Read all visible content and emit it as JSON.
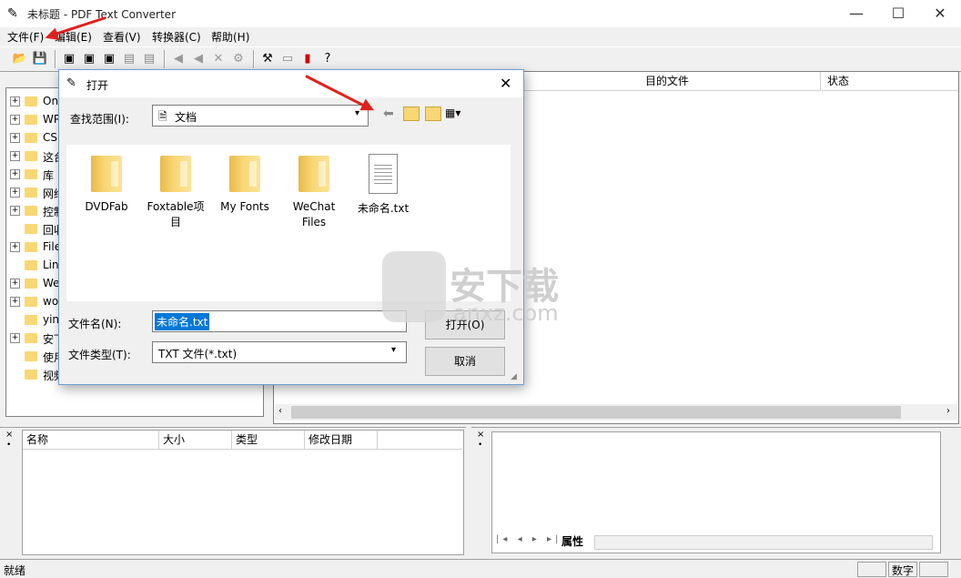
{
  "window": {
    "title": "未标题 - PDF Text Converter",
    "minimize": "—",
    "maximize": "☐",
    "close": "✕"
  },
  "menu": [
    "文件(F)",
    "编辑(E)",
    "查看(V)",
    "转换器(C)",
    "帮助(H)"
  ],
  "tree": {
    "items": [
      {
        "label": "On",
        "expander": "+"
      },
      {
        "label": "WP",
        "expander": "+"
      },
      {
        "label": "CS",
        "expander": "+"
      },
      {
        "label": "这台",
        "expander": "+"
      },
      {
        "label": "库",
        "expander": "+"
      },
      {
        "label": "网络",
        "expander": "+"
      },
      {
        "label": "控制",
        "expander": "+"
      },
      {
        "label": "回收",
        "expander": ""
      },
      {
        "label": "File",
        "expander": "+"
      },
      {
        "label": "Lin",
        "expander": ""
      },
      {
        "label": "We",
        "expander": "+"
      },
      {
        "label": "wo",
        "expander": "+"
      },
      {
        "label": "yin",
        "expander": ""
      },
      {
        "label": "安下",
        "expander": "+"
      },
      {
        "label": "使用",
        "expander": ""
      },
      {
        "label": "视频",
        "expander": ""
      }
    ]
  },
  "main_list": {
    "columns": [
      "目的文件",
      "状态"
    ]
  },
  "bottom_list": {
    "columns": [
      "名称",
      "大小",
      "类型",
      "修改日期"
    ]
  },
  "props": {
    "tab": "属性"
  },
  "status": {
    "left": "就绪",
    "num": "数字"
  },
  "dialog": {
    "title": "打开",
    "look_in_label": "查找范围(I):",
    "look_in_value": "文档",
    "files": [
      {
        "name": "DVDFab",
        "kind": "folder"
      },
      {
        "name": "Foxtable项目",
        "kind": "folder"
      },
      {
        "name": "My Fonts",
        "kind": "folder"
      },
      {
        "name": "WeChat Files",
        "kind": "folder"
      },
      {
        "name": "未命名.txt",
        "kind": "file"
      }
    ],
    "filename_label": "文件名(N):",
    "filename_value": "未命名.txt",
    "filetype_label": "文件类型(T):",
    "filetype_value": "TXT 文件(*.txt)",
    "open_button": "打开(O)",
    "cancel_button": "取消"
  },
  "watermark": {
    "text": "安下载",
    "sub": "anxz.com"
  },
  "colors": {
    "arrow": "#e02020",
    "selection": "#0078d7"
  }
}
